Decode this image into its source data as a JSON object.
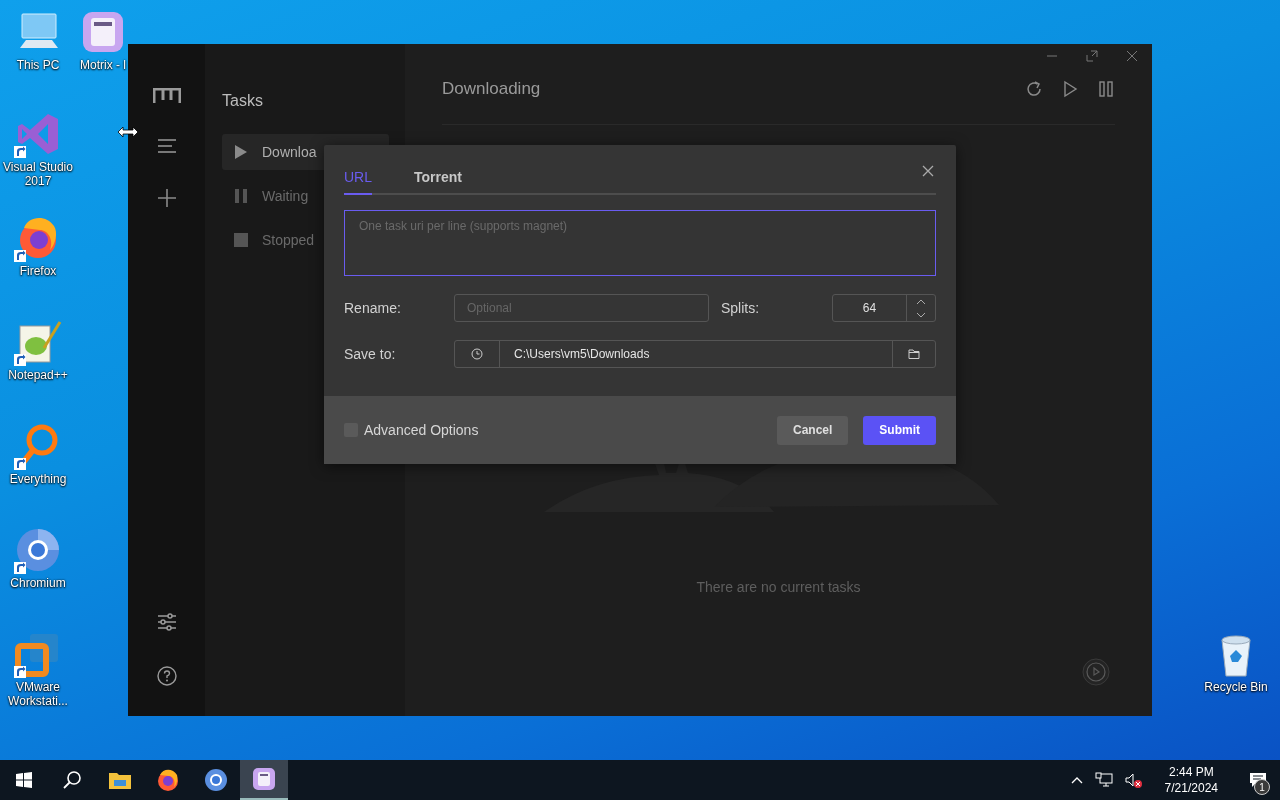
{
  "desktop": {
    "icons": [
      {
        "kind": "pc",
        "label": "This PC",
        "shortcut": false
      },
      {
        "kind": "motrix",
        "label": "Motrix - l",
        "shortcut": false
      },
      {
        "kind": "vs",
        "label": "Visual Studio 2017",
        "shortcut": true
      },
      {
        "kind": "firefox",
        "label": "Firefox",
        "shortcut": true
      },
      {
        "kind": "notepad",
        "label": "Notepad++",
        "shortcut": true
      },
      {
        "kind": "everything",
        "label": "Everything",
        "shortcut": true
      },
      {
        "kind": "chromium",
        "label": "Chromium",
        "shortcut": true
      },
      {
        "kind": "vmware",
        "label": "VMware Workstati...",
        "shortcut": true
      },
      {
        "kind": "recycle",
        "label": "Recycle Bin",
        "shortcut": false
      }
    ]
  },
  "window": {
    "sidebar": {
      "title": "Tasks",
      "items": [
        {
          "kind": "play",
          "label": "Downloa",
          "selected": true
        },
        {
          "kind": "pause",
          "label": "Waiting",
          "selected": false
        },
        {
          "kind": "stop",
          "label": "Stopped",
          "selected": false
        }
      ]
    },
    "main": {
      "title": "Downloading",
      "empty_text": "There are no current tasks"
    },
    "dialog": {
      "tabs": [
        {
          "label": "URL",
          "selected": true
        },
        {
          "label": "Torrent",
          "selected": false
        }
      ],
      "url_field": {
        "placeholder": "One task uri per line (supports magnet)"
      },
      "rename": {
        "label": "Rename:",
        "placeholder": "Optional"
      },
      "splits": {
        "label": "Splits:",
        "value": "64"
      },
      "save_to": {
        "label": "Save to:",
        "value": "C:\\Users\\vm5\\Downloads"
      },
      "advanced": {
        "label": "Advanced Options",
        "checked": false
      },
      "buttons": [
        {
          "kind": "secondary",
          "label": "Cancel"
        },
        {
          "kind": "primary",
          "label": "Submit"
        }
      ]
    }
  },
  "taskbar": {
    "apps": [
      {
        "kind": "explorer",
        "active": false
      },
      {
        "kind": "firefox",
        "active": false
      },
      {
        "kind": "chromium",
        "active": false
      },
      {
        "kind": "motrix",
        "active": true
      }
    ],
    "tray": {
      "time": "2:44 PM",
      "date": "7/21/2024",
      "notifications": "1"
    }
  }
}
